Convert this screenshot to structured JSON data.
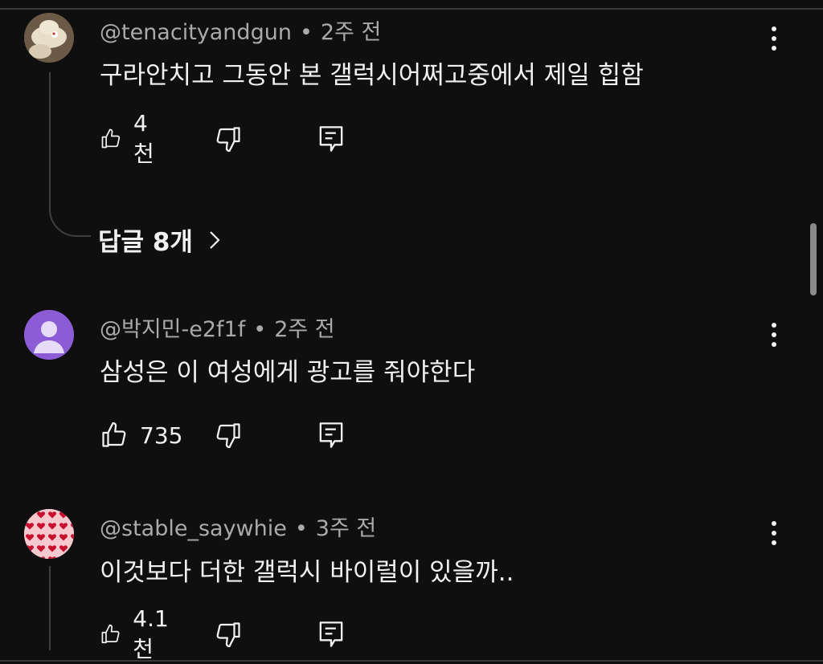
{
  "comments": [
    {
      "author": "@tenacityandgun",
      "separator": "•",
      "time": "2주 전",
      "text": "구라안치고 그동안 본 갤럭시어쩌고중에서 제일 힙함",
      "likes": "4천",
      "replies_label": "답글 8개"
    },
    {
      "author": "@박지민-e2f1f",
      "separator": "•",
      "time": "2주 전",
      "text": "삼성은 이 여성에게 광고를 줘야한다",
      "likes": "735"
    },
    {
      "author": "@stable_saywhie",
      "separator": "•",
      "time": "3주 전",
      "text": "이것보다 더한 갤럭시 바이럴이 있을까..",
      "likes": "4.1천"
    }
  ],
  "colors": {
    "background": "#0f0f0f",
    "primary_text": "#f1f1f1",
    "secondary_text": "#aaaaaa",
    "default_avatar": "#8b5cd6",
    "heart_avatar_bg": "#f6c9cf",
    "heart_color": "#c8102e"
  },
  "icons": {
    "like": "thumbs-up-icon",
    "dislike": "thumbs-down-icon",
    "reply": "reply-comment-icon",
    "menu": "more-vertical-icon",
    "expand": "chevron-right-icon"
  }
}
